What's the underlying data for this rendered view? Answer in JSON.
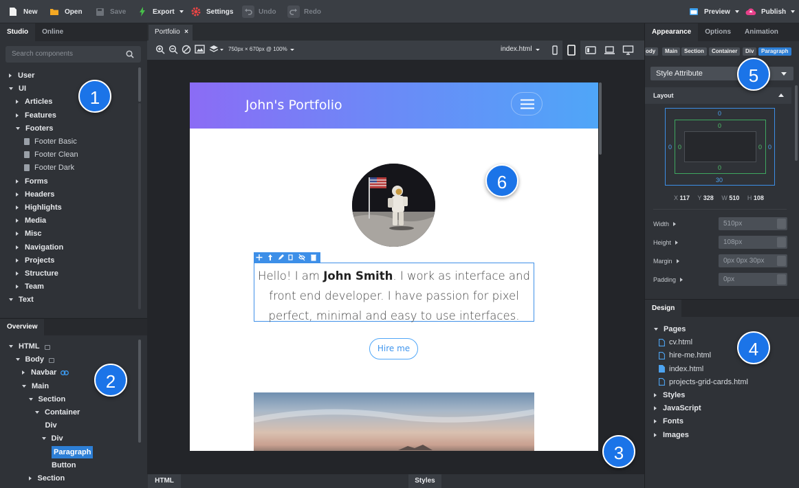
{
  "toolbar": {
    "new": "New",
    "open": "Open",
    "save": "Save",
    "export": "Export",
    "settings": "Settings",
    "undo": "Undo",
    "redo": "Redo",
    "preview": "Preview",
    "publish": "Publish"
  },
  "left": {
    "tabs": [
      "Studio",
      "Online"
    ],
    "search_placeholder": "Search components",
    "components": [
      {
        "label": "User",
        "depth": 0,
        "state": "collapsed"
      },
      {
        "label": "UI",
        "depth": 0,
        "state": "expanded"
      },
      {
        "label": "Articles",
        "depth": 1,
        "state": "collapsed"
      },
      {
        "label": "Features",
        "depth": 1,
        "state": "collapsed"
      },
      {
        "label": "Footers",
        "depth": 1,
        "state": "expanded"
      },
      {
        "label": "Footer Basic",
        "depth": 2,
        "state": "leaf"
      },
      {
        "label": "Footer Clean",
        "depth": 2,
        "state": "leaf"
      },
      {
        "label": "Footer Dark",
        "depth": 2,
        "state": "leaf"
      },
      {
        "label": "Forms",
        "depth": 1,
        "state": "collapsed"
      },
      {
        "label": "Headers",
        "depth": 1,
        "state": "collapsed"
      },
      {
        "label": "Highlights",
        "depth": 1,
        "state": "collapsed"
      },
      {
        "label": "Media",
        "depth": 1,
        "state": "collapsed"
      },
      {
        "label": "Misc",
        "depth": 1,
        "state": "collapsed"
      },
      {
        "label": "Navigation",
        "depth": 1,
        "state": "collapsed"
      },
      {
        "label": "Projects",
        "depth": 1,
        "state": "collapsed"
      },
      {
        "label": "Structure",
        "depth": 1,
        "state": "collapsed"
      },
      {
        "label": "Team",
        "depth": 1,
        "state": "collapsed"
      },
      {
        "label": "Text",
        "depth": 0,
        "state": "expanded"
      }
    ],
    "overview_tab": "Overview",
    "overview": [
      {
        "label": "HTML",
        "depth": 0,
        "state": "expanded",
        "lock": true
      },
      {
        "label": "Body",
        "depth": 1,
        "state": "expanded",
        "lock": true
      },
      {
        "label": "Navbar",
        "depth": 2,
        "state": "collapsed",
        "link": true
      },
      {
        "label": "Main",
        "depth": 2,
        "state": "expanded"
      },
      {
        "label": "Section",
        "depth": 3,
        "state": "expanded"
      },
      {
        "label": "Container",
        "depth": 4,
        "state": "expanded"
      },
      {
        "label": "Div",
        "depth": 5,
        "state": "leaf"
      },
      {
        "label": "Div",
        "depth": 5,
        "state": "expanded"
      },
      {
        "label": "Paragraph",
        "depth": 6,
        "state": "selected"
      },
      {
        "label": "Button",
        "depth": 6,
        "state": "leaf"
      },
      {
        "label": "Section",
        "depth": 3,
        "state": "collapsed"
      }
    ]
  },
  "badges": [
    "1",
    "2",
    "3",
    "4",
    "5",
    "6"
  ],
  "center": {
    "doc_tab": "Portfolio",
    "canvas_size": "750px × 670px @ 100%",
    "file_select": "index.html",
    "page": {
      "brand": "John's Portfolio",
      "para_pre": "Hello! I am ",
      "para_name": "John Smith",
      "para_post": ". I work as interface and front end developer. I have passion for pixel perfect, minimal and easy to use interfaces.",
      "button": "Hire me"
    },
    "bottom_tabs": [
      "HTML",
      "Styles"
    ]
  },
  "right": {
    "tabs": [
      "Appearance",
      "Options",
      "Animation"
    ],
    "breadcrumb": [
      "ody",
      "Main",
      "Section",
      "Container",
      "Div",
      "Paragraph"
    ],
    "style_select": "Style Attribute",
    "layout_title": "Layout",
    "box": {
      "margin_top": "0",
      "margin_left": "0",
      "margin_right": "0",
      "margin_bottom": "30",
      "padding_top": "0",
      "padding_left": "0",
      "padding_right": "0",
      "padding_bottom": "0"
    },
    "coords": [
      {
        "axis": "X",
        "value": "117"
      },
      {
        "axis": "Y",
        "value": "328"
      },
      {
        "axis": "W",
        "value": "510"
      },
      {
        "axis": "H",
        "value": "108"
      }
    ],
    "props": [
      {
        "label": "Width",
        "value": "510px"
      },
      {
        "label": "Height",
        "value": "108px"
      },
      {
        "label": "Margin",
        "value": "0px 0px 30px"
      },
      {
        "label": "Padding",
        "value": "0px"
      }
    ],
    "design_tab": "Design",
    "design": [
      {
        "label": "Pages",
        "state": "expanded"
      },
      {
        "label": "cv.html",
        "state": "file"
      },
      {
        "label": "hire-me.html",
        "state": "file"
      },
      {
        "label": "index.html",
        "state": "file-active"
      },
      {
        "label": "projects-grid-cards.html",
        "state": "file"
      },
      {
        "label": "Styles",
        "state": "collapsed"
      },
      {
        "label": "JavaScript",
        "state": "collapsed"
      },
      {
        "label": "Fonts",
        "state": "collapsed"
      },
      {
        "label": "Images",
        "state": "collapsed"
      }
    ]
  }
}
